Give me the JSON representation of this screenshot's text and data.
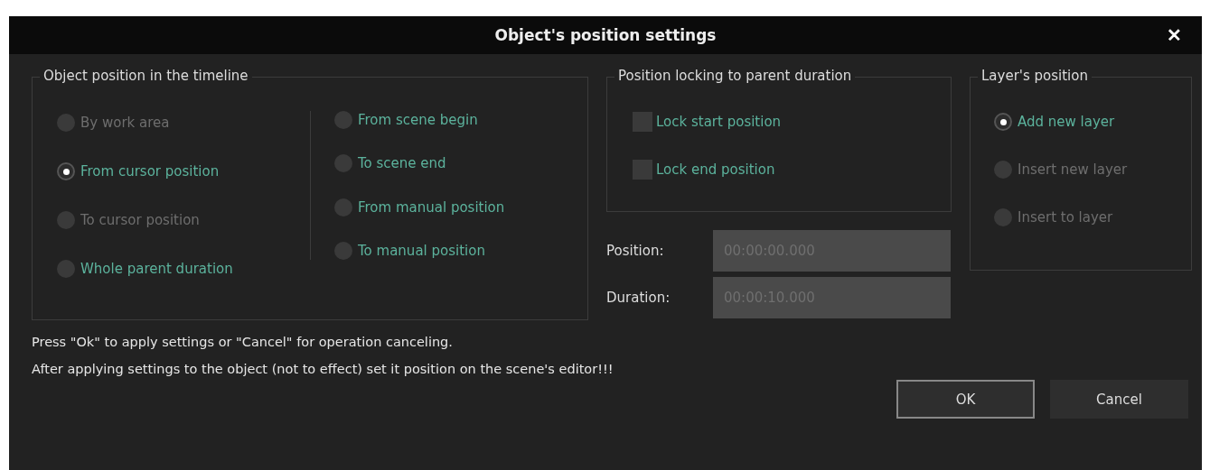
{
  "window": {
    "title": "Object's position settings",
    "close": "✕"
  },
  "timeline_group": {
    "title": "Object position in the timeline",
    "columns": [
      [
        {
          "label": "By work area",
          "selected": false,
          "disabled": true
        },
        {
          "label": "From cursor position",
          "selected": true,
          "disabled": false
        },
        {
          "label": "To cursor position",
          "selected": false,
          "disabled": true
        },
        {
          "label": "Whole parent duration",
          "selected": false,
          "disabled": false
        }
      ],
      [
        {
          "label": "From scene begin",
          "selected": false,
          "disabled": false
        },
        {
          "label": "To scene end",
          "selected": false,
          "disabled": false
        },
        {
          "label": "From manual position",
          "selected": false,
          "disabled": false
        },
        {
          "label": "To manual position",
          "selected": false,
          "disabled": false
        }
      ]
    ]
  },
  "locking_group": {
    "title": "Position locking to parent duration",
    "options": [
      {
        "label": "Lock start position",
        "checked": false
      },
      {
        "label": "Lock end position",
        "checked": false
      }
    ]
  },
  "fields": [
    {
      "label": "Position:",
      "value": "00:00:00.000"
    },
    {
      "label": "Duration:",
      "value": "00:00:10.000"
    }
  ],
  "layer_group": {
    "title": "Layer's position",
    "options": [
      {
        "label": "Add new layer",
        "selected": true,
        "disabled": false
      },
      {
        "label": "Insert new layer",
        "selected": false,
        "disabled": true
      },
      {
        "label": "Insert to layer",
        "selected": false,
        "disabled": true
      }
    ]
  },
  "messages": [
    "Press \"Ok\" to apply settings or \"Cancel\" for operation canceling.",
    "After applying settings to the object (not to effect) set it position on the scene's editor!!!"
  ],
  "buttons": [
    {
      "label": "OK",
      "focused": true
    },
    {
      "label": "Cancel",
      "focused": false
    }
  ]
}
